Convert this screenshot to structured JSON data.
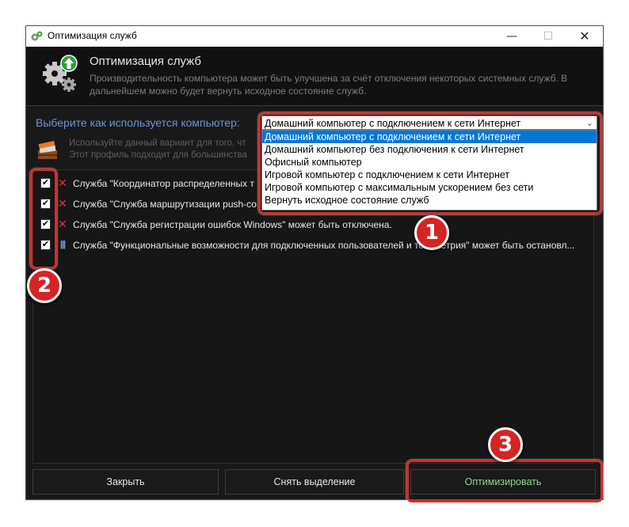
{
  "window": {
    "title": "Оптимизация служб",
    "controls": {
      "minimize": "—",
      "maximize": "☐",
      "close": "✕"
    }
  },
  "header": {
    "title": "Оптимизация служб",
    "description": "Производительность компьютера может быть улучшена за счёт отключения некоторых системных служб. В дальнейшем можно будет вернуть исходное состояние служб."
  },
  "usage": {
    "label": "Выберите как используется компьютер:",
    "selected": "Домашний компьютер с подключением к сети Интернет",
    "options": [
      "Домашний компьютер с подключением к сети Интернет",
      "Домашний компьютер без подключения к сети Интернет",
      "Офисный компьютер",
      "Игровой компьютер с подключением к сети Интернет",
      "Игровой компьютер с максимальным ускорением без сети",
      "Вернуть исходное состояние служб"
    ]
  },
  "profile_description": {
    "line1": "Используйте данный вариант для того, чт",
    "line2": "Этот профиль подходит для большинства"
  },
  "services": [
    {
      "checked": true,
      "status_icon": "red-x-icon",
      "text": "Служба \"Координатор распределенных т"
    },
    {
      "checked": true,
      "status_icon": "red-x-icon",
      "text": "Служба \"Служба маршрутизации push-со"
    },
    {
      "checked": true,
      "status_icon": "red-x-icon",
      "text": "Служба \"Служба регистрации ошибок Windows\" может быть отключена."
    },
    {
      "checked": true,
      "status_icon": "pause-icon",
      "text": "Служба \"Функциональные возможности для подключенных пользователей и телеметрия\" может быть остановл..."
    }
  ],
  "buttons": {
    "close": "Закрыть",
    "deselect": "Снять выделение",
    "optimize": "Оптимизировать"
  },
  "annotations": {
    "b1": "1",
    "b2": "2",
    "b3": "3"
  },
  "colors": {
    "accent_label": "#6f95cf",
    "selection": "#0078d7",
    "callout_red": "#d12c2c",
    "optimize_text": "#8ed58e"
  }
}
